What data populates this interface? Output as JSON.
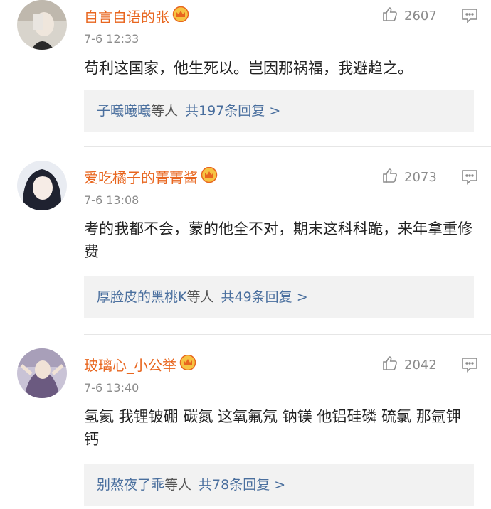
{
  "colors": {
    "username": "#e8661f",
    "link": "#4a6f9e",
    "meta": "#8c8c8c",
    "reply_bg": "#f2f2f2"
  },
  "comments": [
    {
      "username": "自言自语的张",
      "badge_icon": "crown-badge-icon",
      "time": "7-6 12:33",
      "likes": "2607",
      "text": "苟利这国家，他生死以。岂因那祸福，我避趋之。",
      "reply_names": "子曦曦曦",
      "reply_suffix": "等人",
      "reply_count": "共197条回复 >"
    },
    {
      "username": "爱吃橘子的菁菁酱",
      "badge_icon": "crown-badge-icon",
      "time": "7-6 13:08",
      "likes": "2073",
      "text": "考的我都不会，蒙的他全不对，期末这科科跪，来年拿重修费",
      "reply_names": "厚脸皮的黑桃K",
      "reply_suffix": "等人",
      "reply_count": "共49条回复 >"
    },
    {
      "username": "玻璃心_小公举",
      "badge_icon": "crown-badge-icon",
      "time": "7-6 13:40",
      "likes": "2042",
      "text": "氢氦 我锂铍硼 碳氮 这氧氟氖 钠镁 他铝硅磷 硫氯 那氩钾钙",
      "reply_names": "别熬夜了乖",
      "reply_suffix": "等人",
      "reply_count": "共78条回复 >"
    }
  ]
}
